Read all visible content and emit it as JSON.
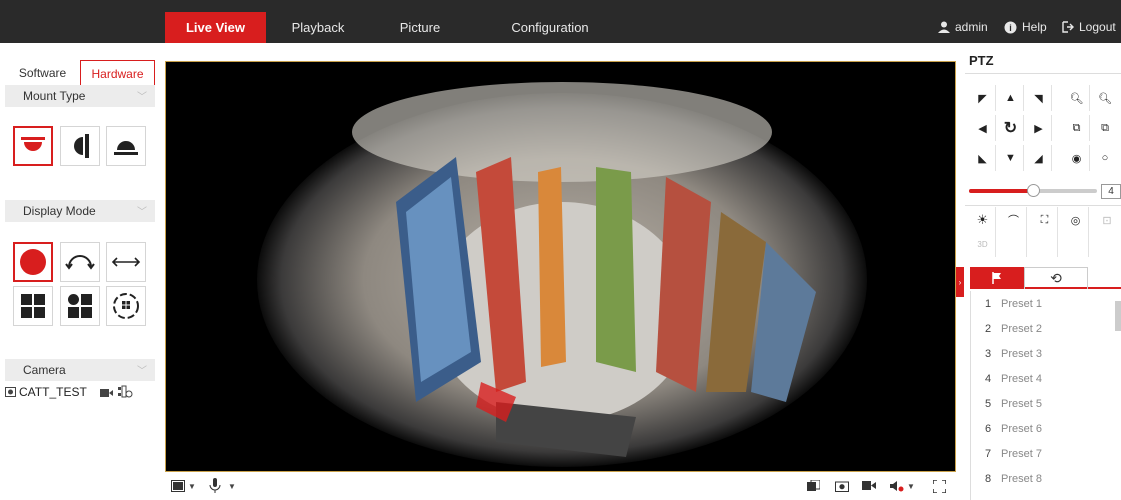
{
  "nav": {
    "tabs": [
      "Live View",
      "Playback",
      "Picture",
      "Configuration"
    ],
    "user": "admin",
    "help": "Help",
    "logout": "Logout"
  },
  "left": {
    "subtabs": [
      "Software",
      "Hardware"
    ],
    "mount_type_label": "Mount Type",
    "display_mode_label": "Display Mode",
    "camera_label": "Camera",
    "camera_name": "CATT_TEST"
  },
  "ptz": {
    "title": "PTZ",
    "speed_value": "4",
    "speed_fraction": 0.5,
    "presets": [
      "Preset 1",
      "Preset 2",
      "Preset 3",
      "Preset 4",
      "Preset 5",
      "Preset 6",
      "Preset 7",
      "Preset 8"
    ],
    "preset_numbers": [
      "1",
      "2",
      "3",
      "4",
      "5",
      "6",
      "7",
      "8"
    ]
  },
  "colors": {
    "accent": "#d81e1e",
    "nav_bg": "#2a2a2a"
  }
}
